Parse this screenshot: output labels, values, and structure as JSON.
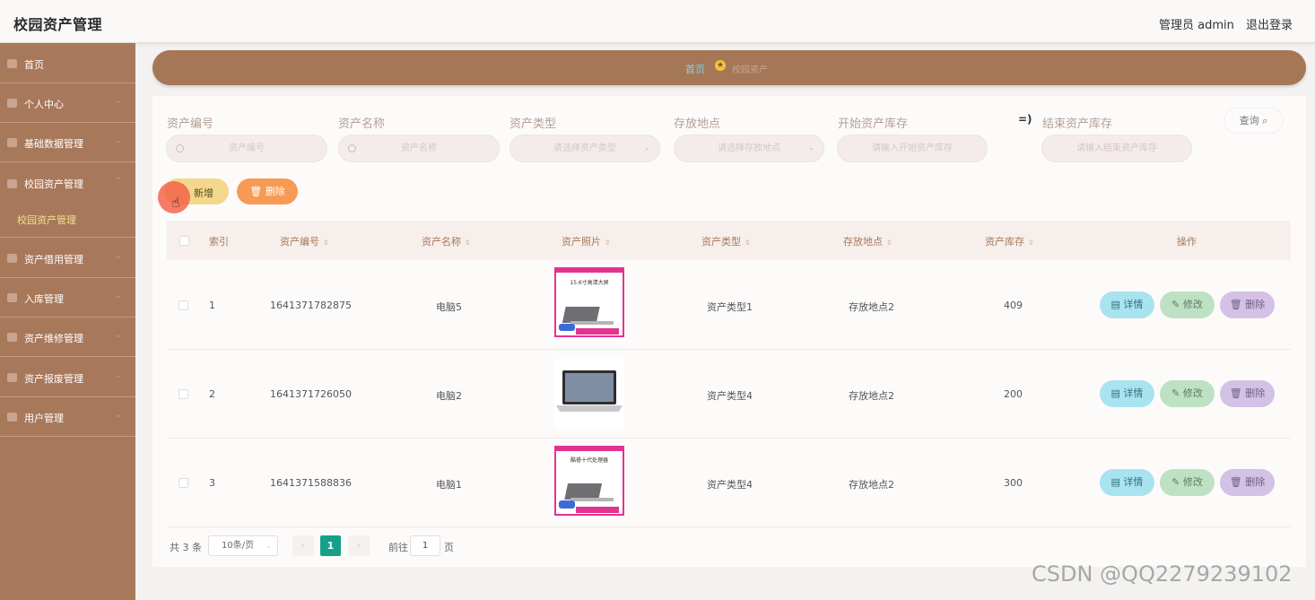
{
  "app": {
    "title": "校园资产管理",
    "user_label": "管理员 admin",
    "logout_label": "退出登录"
  },
  "sidebar": {
    "items": [
      {
        "label": "首页"
      },
      {
        "label": "个人中心"
      },
      {
        "label": "基础数据管理"
      },
      {
        "label": "校园资产管理"
      },
      {
        "label": "资产借用管理"
      },
      {
        "label": "入库管理"
      },
      {
        "label": "资产维修管理"
      },
      {
        "label": "资产报废管理"
      },
      {
        "label": "用户管理"
      }
    ],
    "active_sub": "校园资产管理"
  },
  "breadcrumb": {
    "home": "首页",
    "current": "校园资产"
  },
  "filters": {
    "asset_no": {
      "label": "资产编号",
      "placeholder": "资产编号"
    },
    "asset_name": {
      "label": "资产名称",
      "placeholder": "资产名称"
    },
    "asset_type": {
      "label": "资产类型",
      "placeholder": "请选择资产类型"
    },
    "location": {
      "label": "存放地点",
      "placeholder": "请选择存放地点"
    },
    "stock_start": {
      "label": "开始资产库存",
      "placeholder": "请输入开始资产库存"
    },
    "range_sep": "=)",
    "stock_end": {
      "label": "结束资产库存",
      "placeholder": "请输入结束资产库存"
    },
    "query_label": "查询 ⌕"
  },
  "actions": {
    "add_label": "新增",
    "delete_label": "🗑 删除"
  },
  "table": {
    "headers": {
      "index": "索引",
      "asset_no": "资产编号",
      "asset_name": "资产名称",
      "photo": "资产照片",
      "asset_type": "资产类型",
      "location": "存放地点",
      "stock": "资产库存",
      "ops": "操作"
    },
    "sort_icon": "⇕",
    "rows": [
      {
        "index": "1",
        "asset_no": "1641371782875",
        "asset_name": "电脑5",
        "asset_type": "资产类型1",
        "location": "存放地点2",
        "stock": "409",
        "photo_text": "15.6寸高清大屏"
      },
      {
        "index": "2",
        "asset_no": "1641371726050",
        "asset_name": "电脑2",
        "asset_type": "资产类型4",
        "location": "存放地点2",
        "stock": "200"
      },
      {
        "index": "3",
        "asset_no": "1641371588836",
        "asset_name": "电脑1",
        "asset_type": "资产类型4",
        "location": "存放地点2",
        "stock": "300",
        "photo_text": "酷睿十代处理器"
      }
    ],
    "op_labels": {
      "detail": "▤ 详情",
      "edit": "✎ 修改",
      "remove": "🗑 删除"
    }
  },
  "pagination": {
    "total": "共 3 条",
    "page_size": "10条/页",
    "current_page": "1",
    "goto_label": "前往",
    "goto_value": "1",
    "page_unit": "页"
  },
  "watermark": "CSDN @QQ2279239102"
}
